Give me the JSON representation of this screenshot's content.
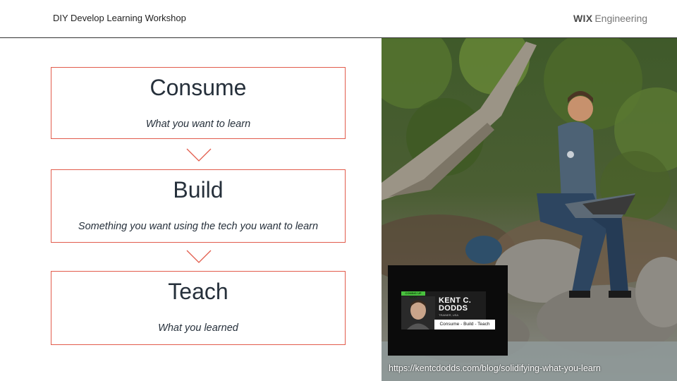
{
  "header": {
    "title": "DIY Develop Learning Workshop",
    "brand_bold": "WIX",
    "brand_rest": "Engineering"
  },
  "steps": [
    {
      "title": "Consume",
      "subtitle": "What you want to learn"
    },
    {
      "title": "Build",
      "subtitle": "Something you want using the tech you want to learn"
    },
    {
      "title": "Teach",
      "subtitle": "What you learned"
    }
  ],
  "video_thumbnail": {
    "tag": "COMING UP NEXT",
    "name": "KENT C.\nDODDS",
    "role": "TRAINER, USA",
    "bar_text": "Consume - Build -     Teach"
  },
  "link": "https://kentcdodds.com/blog/solidifying-what-you-learn",
  "colors": {
    "box_border": "#e25c4c",
    "text": "#26303b",
    "header_line": "#333333"
  },
  "icons": {
    "arrow": "chevron-down-icon"
  }
}
